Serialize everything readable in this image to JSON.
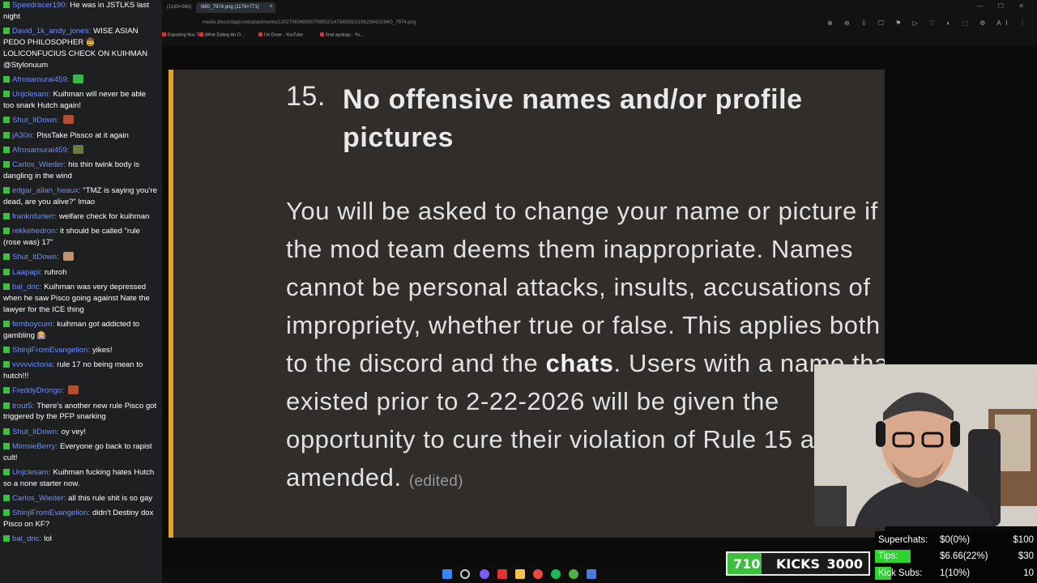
{
  "chat": {
    "messages": [
      {
        "user": "Speedracer190",
        "text": "He was in JSTLKS last night"
      },
      {
        "user": "David_1k_andy_jones",
        "text": "WISE ASIAN PEDO PHILOSOPHER 🤠 LOLICONFUCIUS CHECK ON KUIHMAN @Stylonuum"
      },
      {
        "user": "Afrosamurai459",
        "text": "",
        "emote": "#38b84a"
      },
      {
        "user": "Unjclesam",
        "text": "Kuihman will never be able too snark Hutch again!"
      },
      {
        "user": "Shut_ItDown",
        "text": "",
        "emote": "#b05030"
      },
      {
        "user": "jA30n",
        "text": "PissTake Pissco at it again"
      },
      {
        "user": "Afrosamurai459",
        "text": "",
        "emote": "#6a7a40"
      },
      {
        "user": "Carlos_Wieder",
        "text": "his thin twink body is dangling in the wind"
      },
      {
        "user": "edgar_allan_heaux",
        "text": "\"TMZ is saying you're dead, are you alive?\" lmao"
      },
      {
        "user": "franknfurterr",
        "text": "welfare check for kuihman"
      },
      {
        "user": "rekkehedron",
        "text": "it should be called \"rule (rose was) 17\""
      },
      {
        "user": "Shut_ItDown",
        "text": "",
        "emote": "#c09070"
      },
      {
        "user": "Laapapi",
        "text": "ruhroh"
      },
      {
        "user": "bal_dric",
        "text": "Kuihman was very depressed when he saw Pisco going against Nate the lawyer for the ICE thing"
      },
      {
        "user": "femboycum",
        "text": "kuihman got addicted to gambling 🎰"
      },
      {
        "user": "ShinjiFromEvangelion",
        "text": "yikes!"
      },
      {
        "user": "vvvvvictoria",
        "text": "rule 17 no being mean to hutch!!!"
      },
      {
        "user": "FreddyDrongo",
        "text": "",
        "emote": "#b05030"
      },
      {
        "user": "trout5",
        "text": "There's another new rule Pisco got triggered by the PFP snarking"
      },
      {
        "user": "Shut_ItDown",
        "text": "oy vey!"
      },
      {
        "user": "MimsieBerry",
        "text": "Everyone go back to rapist cult!"
      },
      {
        "user": "Unjclesam",
        "text": "Kuihman fucking hates Hutch so a none starter now."
      },
      {
        "user": "Carlos_Wieder",
        "text": "all this rule shit is so gay"
      },
      {
        "user": "ShinjiFromEvangelion",
        "text": "didn't Destiny dox Pisco on KF?"
      },
      {
        "user": "bal_dric",
        "text": "lol"
      }
    ]
  },
  "browser": {
    "prev_tab": "(1169×960)",
    "active_tab": "IMG_7974.png (1179×771)",
    "new_tab": "+",
    "address": "media.discordapp.net/attachments/1202708349930709002/1475485502196236423/IMG_7974.png",
    "bookmarks": [
      "Exposing Nux Tak...",
      "What Dating An O...",
      "I'm Done - YouTube",
      "final apology - Yo..."
    ],
    "nav_icons": "⊕ ⊖ ⇩ ☐ ⚑ ▷ ♡ ◐ ⬚ ⚙ AI ⋮",
    "window_controls": "— ☐ ✕"
  },
  "rule": {
    "number": "15.",
    "title": "No offensive names and/or profile pictures",
    "body_part1": "You will be asked to change your name or picture if the mod team deems them inappropriate. Names cannot be personal attacks, insults, accusations of impropriety, whether true or false. This applies both to the discord and the ",
    "body_bold": "chats",
    "body_part2": ". Users with a name that existed prior to 2-22-2026 will be given the opportunity to cure their violation of Rule 15 as amended.",
    "edited": "(edited)"
  },
  "kicks": {
    "current": "710",
    "label": "KICKS",
    "goal": "3000",
    "progress": 0.24
  },
  "stats": [
    {
      "label": "Superchats:",
      "value": "$0(0%)",
      "goal": "$100",
      "progress": 0
    },
    {
      "label": "Tips:",
      "value": "$6.66(22%)",
      "goal": "$30",
      "progress": 0.22
    },
    {
      "label": "Kick Subs:",
      "value": "1(10%)",
      "goal": "10",
      "progress": 0.1
    }
  ],
  "colors": {
    "accent_bar": "#e0a12e",
    "chat_username": "#6d8eff",
    "badge": "#3fbf3f",
    "progress": "#3cbf3c"
  }
}
